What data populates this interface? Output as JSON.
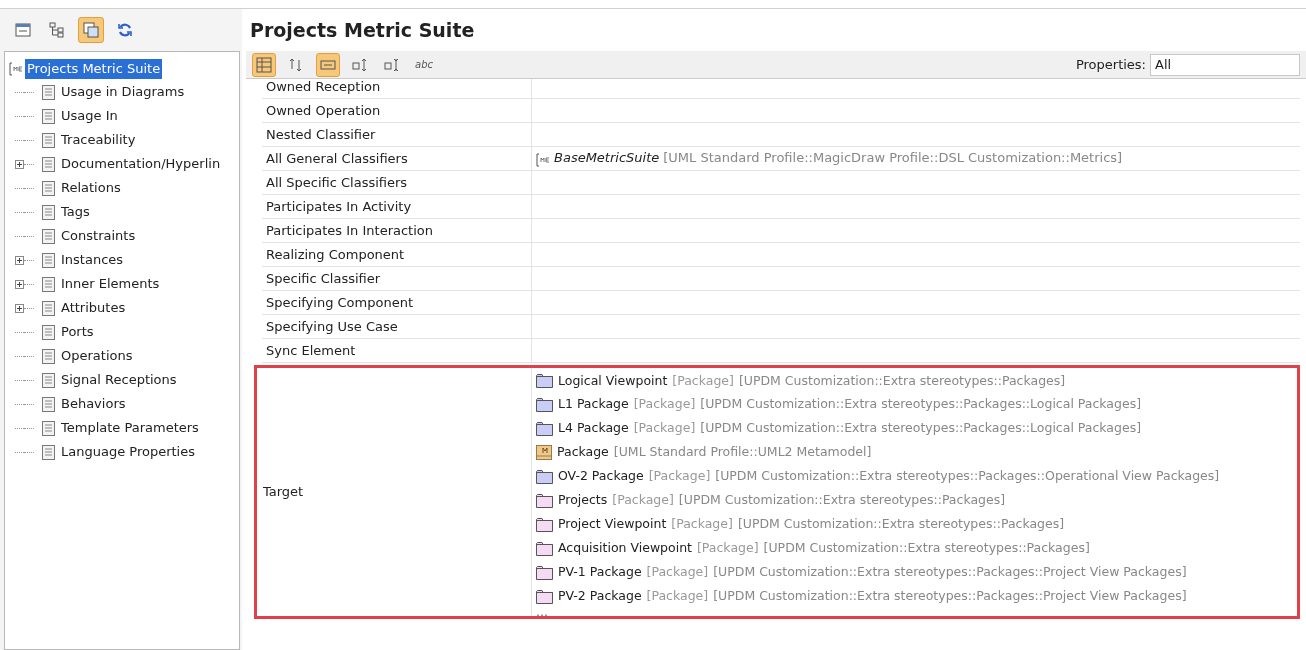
{
  "top_toolbar": [
    {
      "selected": false
    },
    {
      "selected": false
    },
    {
      "selected": true
    },
    {
      "selected": false
    }
  ],
  "title": "Projects Metric Suite",
  "tree": {
    "root": {
      "label": "Projects Metric Suite",
      "selected": true
    },
    "items": [
      {
        "label": "Usage in Diagrams",
        "kind": "leaf"
      },
      {
        "label": "Usage In",
        "kind": "leaf"
      },
      {
        "label": "Traceability",
        "kind": "leaf"
      },
      {
        "label": "Documentation/Hyperlin",
        "kind": "branch",
        "expanded": false
      },
      {
        "label": "Relations",
        "kind": "leaf"
      },
      {
        "label": "Tags",
        "kind": "leaf"
      },
      {
        "label": "Constraints",
        "kind": "leaf"
      },
      {
        "label": "Instances",
        "kind": "branch",
        "expanded": false
      },
      {
        "label": "Inner Elements",
        "kind": "branch",
        "expanded": false
      },
      {
        "label": "Attributes",
        "kind": "branch",
        "expanded": false
      },
      {
        "label": "Ports",
        "kind": "leaf"
      },
      {
        "label": "Operations",
        "kind": "leaf"
      },
      {
        "label": "Signal Receptions",
        "kind": "leaf"
      },
      {
        "label": "Behaviors",
        "kind": "leaf"
      },
      {
        "label": "Template Parameters",
        "kind": "leaf"
      },
      {
        "label": "Language Properties",
        "kind": "leaf"
      }
    ]
  },
  "property_toolbar": [
    {
      "selected": true
    },
    {
      "selected": false
    },
    {
      "selected": true
    },
    {
      "selected": false
    },
    {
      "selected": false
    },
    {
      "label": "abc",
      "selected": false
    }
  ],
  "properties_filter": {
    "label": "Properties:",
    "value": "All"
  },
  "rows": [
    {
      "name": "Owned Reception"
    },
    {
      "name": "Owned Operation"
    },
    {
      "name": "Nested Classifier"
    },
    {
      "name": "All General Classifiers",
      "value": {
        "name": "BaseMetricSuite",
        "path": "[UML Standard Profile::MagicDraw Profile::DSL Customization::Metrics]"
      }
    },
    {
      "name": "All Specific Classifiers"
    },
    {
      "name": "Participates In Activity"
    },
    {
      "name": "Participates In Interaction"
    },
    {
      "name": "Realizing Component"
    },
    {
      "name": "Specific Classifier"
    },
    {
      "name": "Specifying Component"
    },
    {
      "name": "Specifying Use Case"
    },
    {
      "name": "Sync Element"
    }
  ],
  "target": {
    "name": "Target",
    "more": "...",
    "items": [
      {
        "kind": "logical",
        "name": "Logical Viewpoint",
        "type": "[Package]",
        "path": "[UPDM Customization::Extra stereotypes::Packages]"
      },
      {
        "kind": "logical",
        "name": "L1 Package",
        "type": "[Package]",
        "path": "[UPDM Customization::Extra stereotypes::Packages::Logical Packages]"
      },
      {
        "kind": "logical",
        "name": "L4 Package",
        "type": "[Package]",
        "path": "[UPDM Customization::Extra stereotypes::Packages::Logical Packages]"
      },
      {
        "kind": "metamodel",
        "name": "Package",
        "path": "[UML Standard Profile::UML2 Metamodel]"
      },
      {
        "kind": "logical",
        "name": "OV-2 Package",
        "type": "[Package]",
        "path": "[UPDM Customization::Extra stereotypes::Packages::Operational View Packages]"
      },
      {
        "kind": "project",
        "name": "Projects",
        "type": "[Package]",
        "path": "[UPDM Customization::Extra stereotypes::Packages]"
      },
      {
        "kind": "project",
        "name": "Project Viewpoint",
        "type": "[Package]",
        "path": "[UPDM Customization::Extra stereotypes::Packages]"
      },
      {
        "kind": "project",
        "name": "Acquisition Viewpoint",
        "type": "[Package]",
        "path": "[UPDM Customization::Extra stereotypes::Packages]"
      },
      {
        "kind": "project",
        "name": "PV-1 Package",
        "type": "[Package]",
        "path": "[UPDM Customization::Extra stereotypes::Packages::Project View Packages]"
      },
      {
        "kind": "project",
        "name": "PV-2 Package",
        "type": "[Package]",
        "path": "[UPDM Customization::Extra stereotypes::Packages::Project View Packages]"
      }
    ]
  }
}
